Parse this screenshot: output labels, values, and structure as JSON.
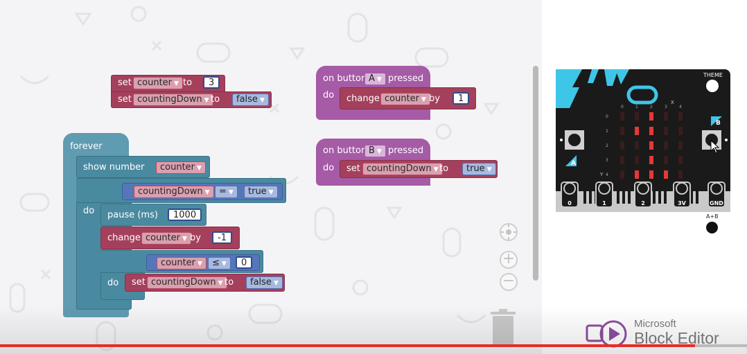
{
  "workspace": {
    "blocks": {
      "set_group": {
        "set1": {
          "kw": "set",
          "var": "counter",
          "to": "to",
          "value": "3"
        },
        "set2": {
          "kw": "set",
          "var": "countingDown",
          "to": "to",
          "value": "false"
        }
      },
      "button_a": {
        "on": "on button",
        "button": "A",
        "pressed": "pressed",
        "do": "do",
        "change": "change",
        "var": "counter",
        "by": "by",
        "value": "1"
      },
      "button_b": {
        "on": "on button",
        "button": "B",
        "pressed": "pressed",
        "do": "do",
        "set": "set",
        "var": "countingDown",
        "to": "to",
        "value": "true"
      },
      "forever": {
        "label": "forever",
        "show_number": "show number",
        "show_var": "counter",
        "if1": {
          "if": "if",
          "var": "countingDown",
          "op": "=",
          "value": "true",
          "do": "do"
        },
        "pause": {
          "label": "pause (ms)",
          "value": "1000"
        },
        "change": {
          "label": "change",
          "var": "counter",
          "by": "by",
          "value": "-1"
        },
        "if2": {
          "if": "if",
          "var": "counter",
          "op": "≤",
          "value": "0",
          "do": "do"
        },
        "set_inner": {
          "label": "set",
          "var": "countingDown",
          "to": "to",
          "value": "false"
        }
      }
    },
    "zoom_icons": [
      "target-icon",
      "zoom-in-icon",
      "zoom-out-icon"
    ],
    "trash_icon": "trash-icon"
  },
  "simulator": {
    "theme_label": "THEME",
    "ab_label": "A+B",
    "button_a_label": "A",
    "button_b_label": "B",
    "pins": [
      "0",
      "1",
      "2",
      "3V",
      "GND"
    ],
    "col_labels": [
      "0",
      "1",
      "2",
      "3",
      "4"
    ],
    "row_labels": [
      "0",
      "1",
      "2",
      "3",
      "4"
    ],
    "x_label": "X",
    "y_label": "Y",
    "led_rows": [
      "00100",
      "01100",
      "00100",
      "00100",
      "01110"
    ],
    "colors": {
      "board": "#1a1a1a",
      "accent": "#3ec6e8",
      "led_on": "#e53935",
      "led_off": "#3a1c1c"
    }
  },
  "brand": {
    "line1": "Microsoft",
    "line2": "Block Editor"
  },
  "video": {
    "progress_percent": 93
  }
}
